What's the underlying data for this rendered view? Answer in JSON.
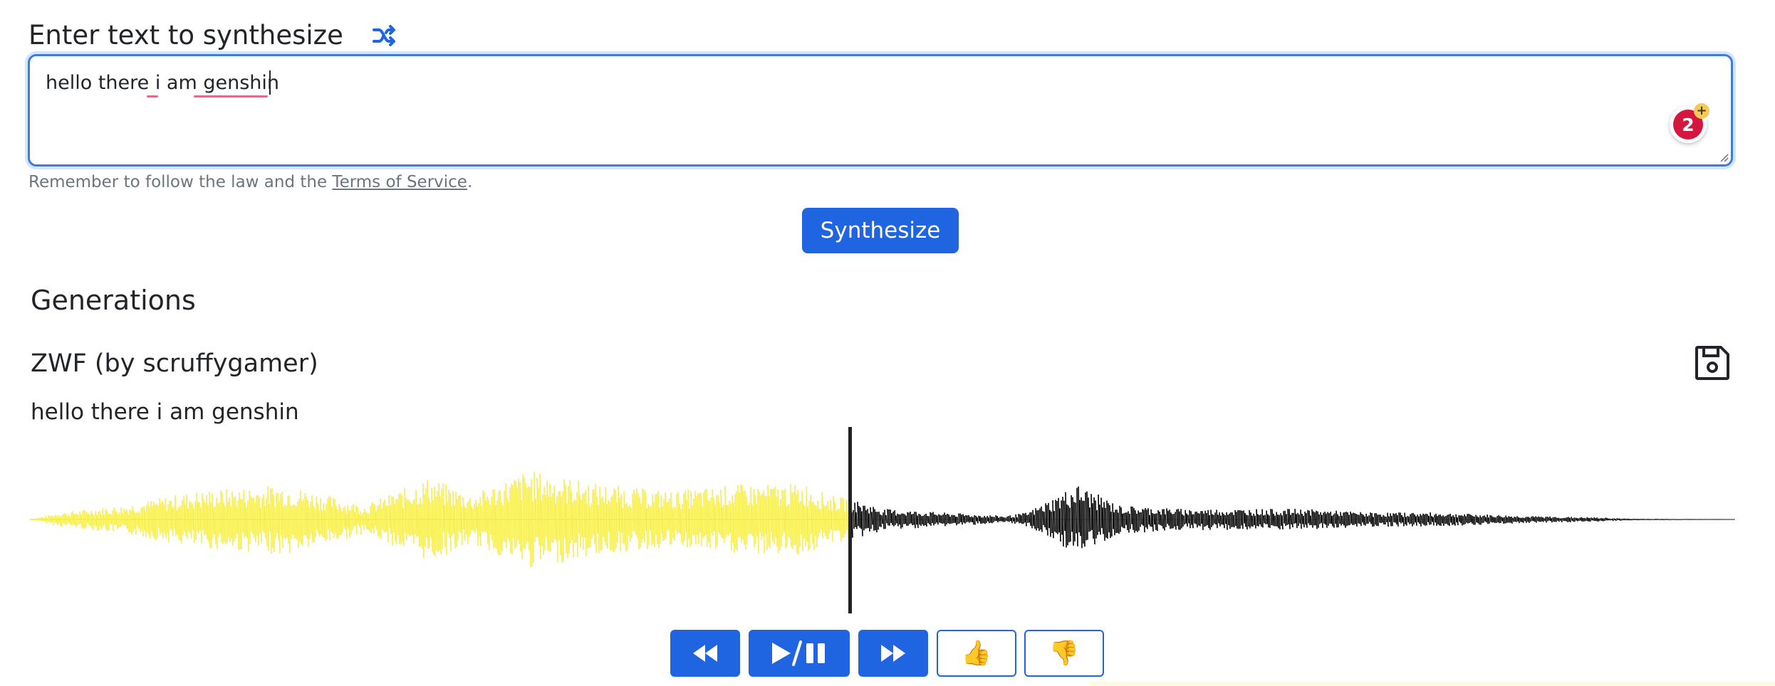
{
  "prompt": {
    "label": "Enter text to synthesize",
    "shuffle_icon": "shuffle-icon",
    "value": "hello there i am genshin",
    "grammarly_count": "2",
    "grammarly_plus": "+"
  },
  "legal": {
    "prefix": "Remember to follow the law and the ",
    "link": "Terms of Service",
    "suffix": "."
  },
  "actions": {
    "synthesize_label": "Synthesize"
  },
  "generations": {
    "title": "Generations",
    "items": [
      {
        "voice": "ZWF (by scruffygamer)",
        "text": "hello there i am genshin",
        "progress": 0.48,
        "played_color": "#f5ec5a",
        "unplayed_color": "#000000",
        "controls": {
          "rewind_icon": "rewind-icon",
          "play_pause_icon": "play-pause-icon",
          "forward_icon": "fast-forward-icon",
          "thumbs_up": "👍",
          "thumbs_down": "👎"
        }
      }
    ]
  },
  "colors": {
    "accent": "#1f64e0",
    "focus_border": "#3c7be4",
    "muted_text": "#6c757d",
    "grammarly": "#d3173f"
  }
}
